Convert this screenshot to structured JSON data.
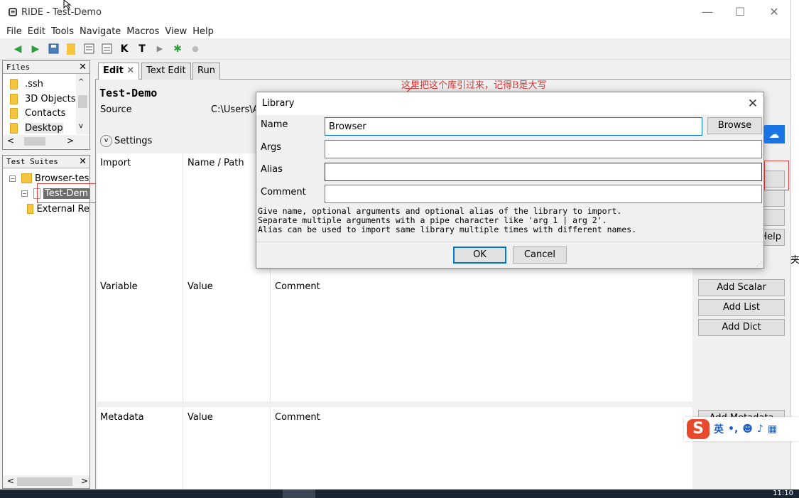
{
  "window": {
    "title": "RIDE - Test-Demo"
  },
  "menu": [
    "File",
    "Edit",
    "Tools",
    "Navigate",
    "Macros",
    "View",
    "Help"
  ],
  "files_panel": {
    "title": "Files",
    "items": [
      ".ssh",
      "3D Objects",
      "Contacts",
      "Desktop"
    ]
  },
  "suites_panel": {
    "title": "Test Suites",
    "items": [
      "Browser-tes",
      "Test-Dem",
      "External Re"
    ]
  },
  "tabs": [
    "Edit",
    "Text Edit",
    "Run"
  ],
  "editor": {
    "suite_name": "Test-Demo",
    "source_label": "Source",
    "source_value": "C:\\Users\\A",
    "settings_label": "Settings",
    "import_cols": [
      "Import",
      "Name / Path"
    ],
    "variable_cols": [
      "Variable",
      "Value",
      "Comment"
    ],
    "metadata_cols": [
      "Metadata",
      "Value",
      "Comment"
    ],
    "help_btn": "Help",
    "add_scalar": "Add Scalar",
    "add_list": "Add List",
    "add_dict": "Add Dict",
    "add_metadata": "Add Metadata"
  },
  "annotation": "这里把这个库引过来，记得B是大写",
  "dialog": {
    "title": "Library",
    "name_label": "Name",
    "name_value": "Browser",
    "browse_btn": "Browse",
    "args_label": "Args",
    "alias_label": "Alias",
    "comment_label": "Comment",
    "help_line1": "Give name, optional arguments and optional alias of the library to import.",
    "help_line2": "Separate multiple arguments with a pipe character like 'arg 1 | arg 2'.",
    "help_line3": "Alias can be used to import same library multiple times with different names.",
    "ok_btn": "OK",
    "cancel_btn": "Cancel"
  },
  "ime": {
    "logo": "S",
    "lang": "英"
  },
  "taskbar": {
    "clock": "11:10"
  },
  "side_text": "夹"
}
